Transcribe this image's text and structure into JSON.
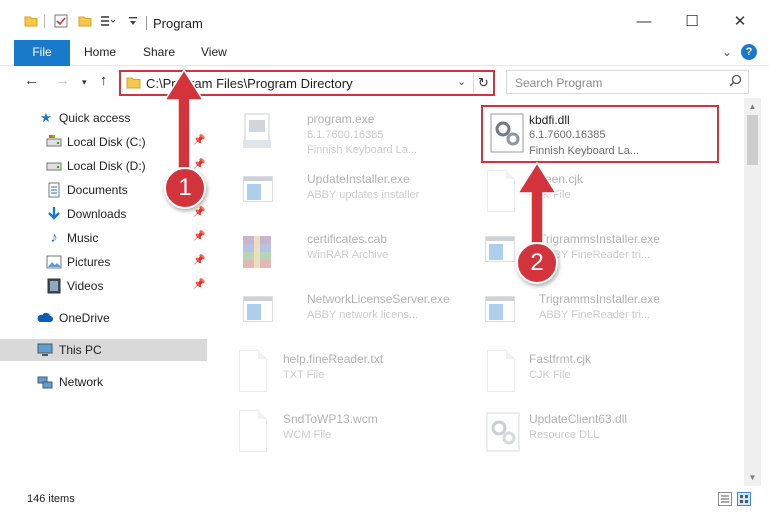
{
  "window": {
    "title": "Program",
    "minimize_glyph": "—",
    "maximize_glyph": "☐",
    "close_glyph": "✕"
  },
  "ribbon": {
    "file": "File",
    "tabs": [
      "Home",
      "Share",
      "View"
    ],
    "help": "?"
  },
  "address_bar": {
    "path": "C:\\Program Files\\Program Directory",
    "search_placeholder": "Search Program"
  },
  "sidebar": {
    "items": [
      {
        "label": "Quick access",
        "icon": "star-icon",
        "pinned": false
      },
      {
        "label": "Local Disk (C:)",
        "icon": "drive-icon",
        "pinned": true
      },
      {
        "label": "Local Disk (D:)",
        "icon": "drive-icon",
        "pinned": true
      },
      {
        "label": "Documents",
        "icon": "documents-icon",
        "pinned": true
      },
      {
        "label": "Downloads",
        "icon": "download-icon",
        "pinned": true
      },
      {
        "label": "Music",
        "icon": "music-icon",
        "pinned": true
      },
      {
        "label": "Pictures",
        "icon": "pictures-icon",
        "pinned": true
      },
      {
        "label": "Videos",
        "icon": "videos-icon",
        "pinned": true
      },
      {
        "label": "OneDrive",
        "icon": "cloud-icon",
        "pinned": false
      },
      {
        "label": "This PC",
        "icon": "computer-icon",
        "pinned": false
      },
      {
        "label": "Network",
        "icon": "network-icon",
        "pinned": false
      }
    ]
  },
  "files": [
    {
      "name": "program.exe",
      "line2": "6.1.7600.16385",
      "line3": "Finnish Keyboard La...",
      "icon": "program-exe-icon"
    },
    {
      "name": "kbdfi.dll",
      "line2": "6.1.7600.16385",
      "line3": "Finnish Keyboard La...",
      "icon": "dll-gear-icon"
    },
    {
      "name": "UpdateInstaller.exe",
      "line2": "ABBY updates installer",
      "icon": "exe-window-icon"
    },
    {
      "name": "screen.cjk",
      "line2": "CJK File",
      "icon": "blank-doc-icon"
    },
    {
      "name": "certificates.cab",
      "line2": "WinRAR Archive",
      "icon": "winrar-archive-icon"
    },
    {
      "name": "TrigrammsInstaller.exe",
      "line2": "ABBY FineReader tri...",
      "icon": "exe-window-icon"
    },
    {
      "name": "NetworkLicenseServer.exe",
      "line2": "ABBY network licens...",
      "icon": "exe-window-icon"
    },
    {
      "name": "TrigrammsInstaller.exe",
      "line2": "ABBY FineReader tri...",
      "icon": "exe-window-icon"
    },
    {
      "name": "help.fineReader.txt",
      "line2": "TXT File",
      "icon": "blank-doc-icon"
    },
    {
      "name": "Fastfrmt.cjk",
      "line2": "CJK File",
      "icon": "blank-doc-icon"
    },
    {
      "name": "SndToWP13.wcm",
      "line2": "WCM File",
      "icon": "blank-doc-icon"
    },
    {
      "name": "UpdateClient63.dll",
      "line2": "Resource DLL",
      "icon": "dll-gear-icon"
    }
  ],
  "annotations": {
    "step1": "1",
    "step2": "2",
    "color": "#d3343c"
  },
  "status": {
    "item_count": "146 items"
  }
}
